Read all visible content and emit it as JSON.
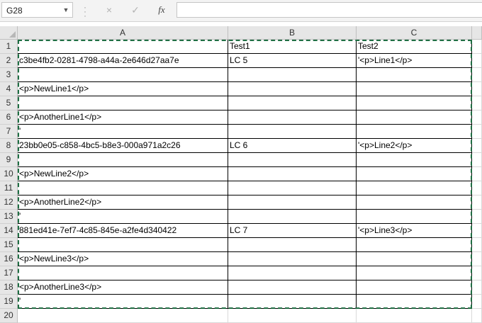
{
  "name_box": {
    "value": "G28"
  },
  "formula_bar": {
    "cancel_icon": "×",
    "enter_icon": "✓",
    "fx_label": "fx",
    "content": ""
  },
  "columns": [
    "A",
    "B",
    "C"
  ],
  "rows": [
    {
      "num": "1",
      "a": "",
      "b": "Test1",
      "c": "Test2"
    },
    {
      "num": "2",
      "a": "c3be4fb2-0281-4798-a44a-2e646d27aa7e",
      "b": "LC 5",
      "c": "'<p>Line1</p>"
    },
    {
      "num": "3",
      "a": "",
      "b": "",
      "c": ""
    },
    {
      "num": "4",
      "a": "<p>NewLine1</p>",
      "b": "",
      "c": ""
    },
    {
      "num": "5",
      "a": "",
      "b": "",
      "c": ""
    },
    {
      "num": "6",
      "a": "<p>AnotherLine1</p>",
      "b": "",
      "c": ""
    },
    {
      "num": "7",
      "a": "'",
      "b": "",
      "c": ""
    },
    {
      "num": "8",
      "a": "23bb0e05-c858-4bc5-b8e3-000a971a2c26",
      "b": "LC 6",
      "c": "'<p>Line2</p>"
    },
    {
      "num": "9",
      "a": "",
      "b": "",
      "c": ""
    },
    {
      "num": "10",
      "a": "<p>NewLine2</p>",
      "b": "",
      "c": ""
    },
    {
      "num": "11",
      "a": "",
      "b": "",
      "c": ""
    },
    {
      "num": "12",
      "a": "<p>AnotherLine2</p>",
      "b": "",
      "c": ""
    },
    {
      "num": "13",
      "a": "'",
      "b": "",
      "c": ""
    },
    {
      "num": "14",
      "a": "881ed41e-7ef7-4c85-845e-a2fe4d340422",
      "b": "LC 7",
      "c": "'<p>Line3</p>"
    },
    {
      "num": "15",
      "a": "",
      "b": "",
      "c": ""
    },
    {
      "num": "16",
      "a": "<p>NewLine3</p>",
      "b": "",
      "c": ""
    },
    {
      "num": "17",
      "a": "",
      "b": "",
      "c": ""
    },
    {
      "num": "18",
      "a": "<p>AnotherLine3</p>",
      "b": "",
      "c": ""
    },
    {
      "num": "19",
      "a": "'",
      "b": "",
      "c": ""
    },
    {
      "num": "20",
      "a": "",
      "b": "",
      "c": ""
    }
  ],
  "colors": {
    "marquee": "#1f6e43",
    "header_bg": "#e6e6e6",
    "toolbar_bg": "#f3f3f3"
  }
}
